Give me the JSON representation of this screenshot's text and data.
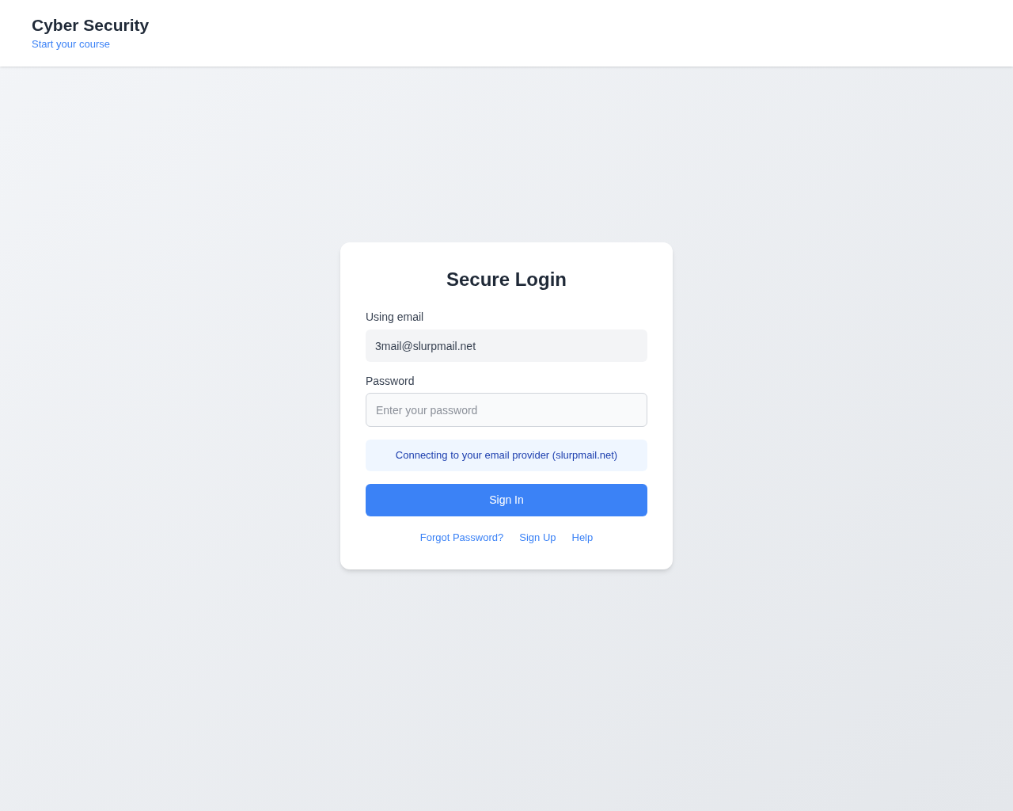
{
  "header": {
    "title": "Cyber Security",
    "subtitle": "Start your course"
  },
  "login": {
    "title": "Secure Login",
    "email": {
      "label": "Using email",
      "value": "3mail@slurpmail.net"
    },
    "password": {
      "label": "Password",
      "placeholder": "Enter your password"
    },
    "notice": "Connecting to your email provider (slurpmail.net)",
    "button": "Sign In",
    "links": [
      "Forgot Password?",
      "Sign Up",
      "Help"
    ]
  }
}
